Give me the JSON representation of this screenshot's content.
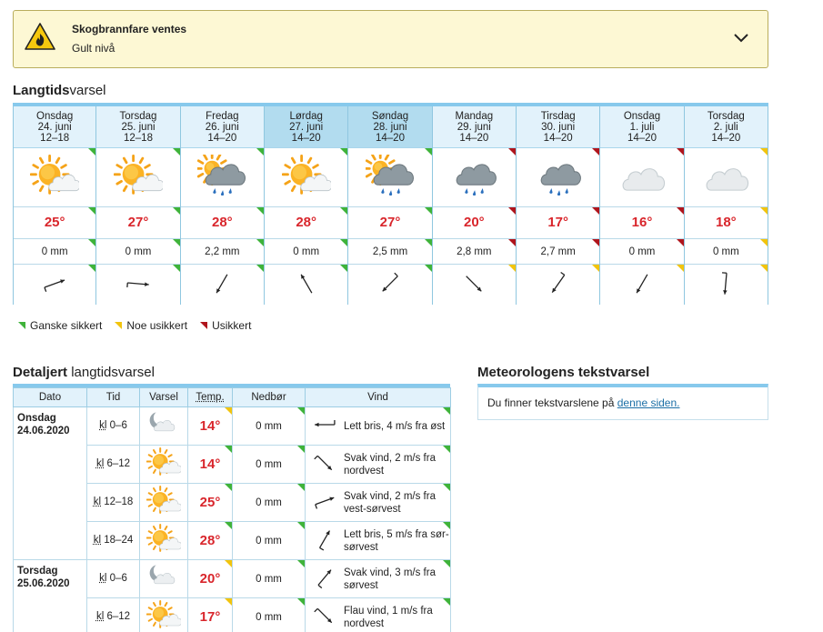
{
  "alert": {
    "title": "Skogbrannfare ventes",
    "level": "Gult nivå"
  },
  "langtid": {
    "title_bold": "Langtids",
    "title_rest": "varsel",
    "days": [
      {
        "weekday": "Onsdag",
        "date": "24. juni",
        "period": "12–18",
        "weather": "partly-cloudy",
        "temp": "25°",
        "precip": "0 mm",
        "wind_deg": 70,
        "wind_type": "light",
        "certainty": "green",
        "weekend": false
      },
      {
        "weekday": "Torsdag",
        "date": "25. juni",
        "period": "12–18",
        "weather": "partly-cloudy",
        "temp": "27°",
        "precip": "0 mm",
        "wind_deg": 95,
        "wind_type": "light",
        "certainty": "green",
        "weekend": false
      },
      {
        "weekday": "Fredag",
        "date": "26. juni",
        "period": "14–20",
        "weather": "rain-sun",
        "temp": "28°",
        "precip": "2,2 mm",
        "wind_deg": 210,
        "wind_type": "calm",
        "certainty": "green",
        "weekend": false
      },
      {
        "weekday": "Lørdag",
        "date": "27. juni",
        "period": "14–20",
        "weather": "partly-cloudy",
        "temp": "28°",
        "precip": "0 mm",
        "wind_deg": 330,
        "wind_type": "calm",
        "certainty": "green",
        "weekend": true
      },
      {
        "weekday": "Søndag",
        "date": "28. juni",
        "period": "14–20",
        "weather": "rain-sun",
        "temp": "27°",
        "precip": "2,5 mm",
        "wind_deg": 225,
        "wind_type": "light",
        "certainty": "green",
        "weekend": true
      },
      {
        "weekday": "Mandag",
        "date": "29. juni",
        "period": "14–20",
        "weather": "rain",
        "temp": "20°",
        "precip": "2,8 mm",
        "wind_deg": 135,
        "wind_type": "calm",
        "certainty": "red",
        "weekend": false
      },
      {
        "weekday": "Tirsdag",
        "date": "30. juni",
        "period": "14–20",
        "weather": "rain",
        "temp": "17°",
        "precip": "2,7 mm",
        "wind_deg": 215,
        "wind_type": "light",
        "certainty": "red",
        "weekend": false
      },
      {
        "weekday": "Onsdag",
        "date": "1. juli",
        "period": "14–20",
        "weather": "cloudy",
        "temp": "16°",
        "precip": "0 mm",
        "wind_deg": 210,
        "wind_type": "calm",
        "certainty": "red",
        "weekend": false
      },
      {
        "weekday": "Torsdag",
        "date": "2. juli",
        "period": "14–20",
        "weather": "cloudy",
        "temp": "18°",
        "precip": "0 mm",
        "wind_deg": 185,
        "wind_type": "light",
        "certainty": "yellow",
        "weekend": false
      }
    ]
  },
  "legend": {
    "sure": "Ganske sikkert",
    "some": "Noe usikkert",
    "unsure": "Usikkert"
  },
  "detaljert": {
    "title_bold": "Detaljert",
    "title_rest": " langtidsvarsel",
    "headers": [
      "Dato",
      "Tid",
      "Varsel",
      "Temp.",
      "Nedbør",
      "Vind"
    ],
    "rows": [
      {
        "date_day": "Onsdag",
        "date_full": "24.06.2020",
        "kl": "kl",
        "time": " 0–6",
        "weather": "night",
        "temp": "14°",
        "precip": "0 mm",
        "wind_deg": 270,
        "wind_text": "Lett bris, 4 m/s fra øst",
        "temp_cert": "yellow",
        "wind_cert": "green"
      },
      {
        "date_day": "",
        "date_full": "",
        "kl": "kl",
        "time": " 6–12",
        "weather": "partly-cloudy",
        "temp": "14°",
        "precip": "0 mm",
        "wind_deg": 135,
        "wind_text": "Svak vind, 2 m/s fra nordvest",
        "temp_cert": "green",
        "wind_cert": "green"
      },
      {
        "date_day": "",
        "date_full": "",
        "kl": "kl",
        "time": " 12–18",
        "weather": "partly-cloudy",
        "temp": "25°",
        "precip": "0 mm",
        "wind_deg": 70,
        "wind_text": "Svak vind, 2 m/s fra vest-sørvest",
        "temp_cert": "green",
        "wind_cert": "green"
      },
      {
        "date_day": "",
        "date_full": "",
        "kl": "kl",
        "time": " 18–24",
        "weather": "partly-cloudy",
        "temp": "28°",
        "precip": "0 mm",
        "wind_deg": 30,
        "wind_text": "Lett bris, 5 m/s fra sør-sørvest",
        "temp_cert": "green",
        "wind_cert": "green"
      },
      {
        "date_day": "Torsdag",
        "date_full": "25.06.2020",
        "kl": "kl",
        "time": " 0–6",
        "weather": "night",
        "temp": "20°",
        "precip": "0 mm",
        "wind_deg": 40,
        "wind_text": "Svak vind, 3 m/s fra sørvest",
        "temp_cert": "yellow",
        "wind_cert": "green"
      },
      {
        "date_day": "",
        "date_full": "",
        "kl": "kl",
        "time": " 6–12",
        "weather": "partly-cloudy",
        "temp": "17°",
        "precip": "0 mm",
        "wind_deg": 135,
        "wind_text": "Flau vind, 1 m/s fra nordvest",
        "temp_cert": "yellow",
        "wind_cert": "green"
      }
    ]
  },
  "meteorolog": {
    "title": "Meteorologens tekstvarsel",
    "text": "Du finner tekstvarslene på ",
    "link": "denne siden."
  }
}
